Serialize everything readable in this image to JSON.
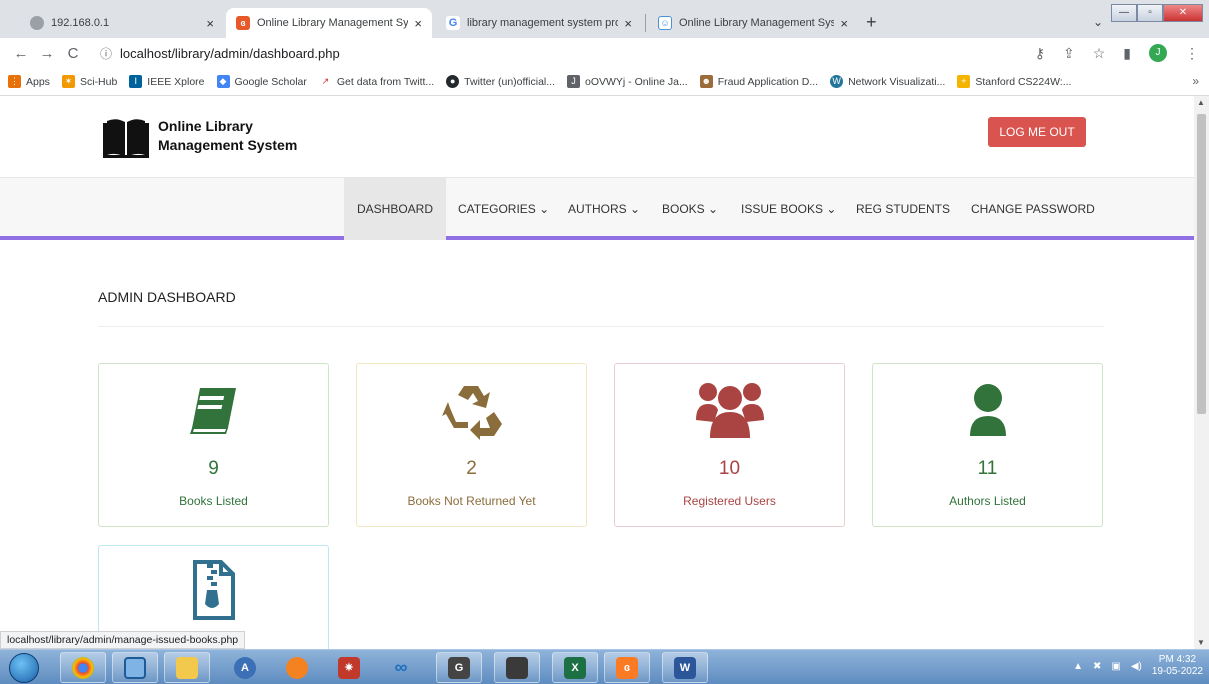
{
  "browser": {
    "tabs": [
      {
        "title": "192.168.0.1",
        "favicon": "globe-icon",
        "active": false
      },
      {
        "title": "Online Library Management Syst",
        "favicon": "library-icon",
        "active": true
      },
      {
        "title": "library management system proj",
        "favicon": "google-icon",
        "active": false
      },
      {
        "title": "Online Library Management Syst",
        "favicon": "library-icon",
        "active": false
      }
    ],
    "new_tab": "+",
    "close_glyph": "×",
    "url": "localhost/library/admin/dashboard.php",
    "profile_initial": "J",
    "bookmarks": [
      {
        "label": "Apps",
        "icon": "apps-grid-icon",
        "color": "#e8710a"
      },
      {
        "label": "Sci-Hub",
        "icon": "scihub-icon",
        "color": "#f29900"
      },
      {
        "label": "IEEE Xplore",
        "icon": "ieee-icon",
        "color": "#00629b"
      },
      {
        "label": "Google Scholar",
        "icon": "scholar-icon",
        "color": "#4285f4"
      },
      {
        "label": "Get data from Twitt...",
        "icon": "chart-icon",
        "color": "#d93025"
      },
      {
        "label": "Twitter (un)official...",
        "icon": "github-icon",
        "color": "#24292e"
      },
      {
        "label": "oOVWYj - Online Ja...",
        "icon": "jdoodle-icon",
        "color": "#5f6368"
      },
      {
        "label": "Fraud Application D...",
        "icon": "fraud-icon",
        "color": "#9c6b3a"
      },
      {
        "label": "Network Visualizati...",
        "icon": "wordpress-icon",
        "color": "#21759b"
      },
      {
        "label": "Stanford CS224W:...",
        "icon": "stanford-icon",
        "color": "#f4b400"
      }
    ],
    "bookmarks_more": "»",
    "status_url": "localhost/library/admin/manage-issued-books.php"
  },
  "site": {
    "logo_line1": "Online Library",
    "logo_line2": "Management System",
    "logout_label": "LOG ME OUT",
    "menu": [
      {
        "label": "DASHBOARD",
        "active": true
      },
      {
        "label": "CATEGORIES ⌄"
      },
      {
        "label": "AUTHORS ⌄"
      },
      {
        "label": "BOOKS ⌄"
      },
      {
        "label": "ISSUE BOOKS ⌄"
      },
      {
        "label": "REG STUDENTS"
      },
      {
        "label": "CHANGE PASSWORD"
      }
    ],
    "accent_color": "#9170e4"
  },
  "dashboard": {
    "title": "ADMIN DASHBOARD",
    "cards": [
      {
        "value": "9",
        "label": "Books Listed",
        "icon": "book-icon",
        "color": "#31733a"
      },
      {
        "value": "2",
        "label": "Books Not Returned Yet",
        "icon": "recycle-icon",
        "color": "#8a6d3b"
      },
      {
        "value": "10",
        "label": "Registered Users",
        "icon": "users-icon",
        "color": "#a94442"
      },
      {
        "value": "11",
        "label": "Authors Listed",
        "icon": "user-icon",
        "color": "#31733a"
      },
      {
        "value": "",
        "label": "",
        "icon": "file-zip-icon",
        "color": "#31708f"
      }
    ]
  },
  "taskbar": {
    "clock_time": "PM 4:32",
    "clock_date": "19-05-2022",
    "apps": [
      "chrome-icon",
      "virtualbox-icon",
      "explorer-icon",
      "anaconda-icon",
      "blender-icon",
      "spider-icon",
      "infinity-icon",
      "gimp-icon",
      "sublime-icon",
      "excel-icon",
      "xampp-icon",
      "word-icon"
    ]
  }
}
